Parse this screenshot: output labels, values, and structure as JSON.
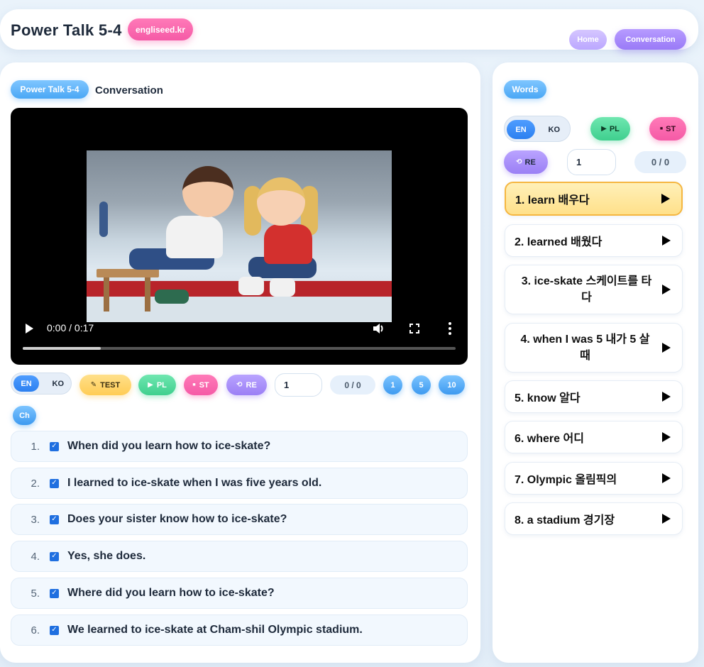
{
  "header": {
    "title": "Power Talk 5-4",
    "brand": "engliseed.kr",
    "home": "Home",
    "conversation": "Conversation"
  },
  "left": {
    "tag": "Power Talk 5-4",
    "label": "Conversation",
    "video": {
      "time": "0:00 / 0:17",
      "progress": 0.18
    },
    "controls": {
      "en": "EN",
      "ko": "KO",
      "test": "TEST",
      "pl": "PL",
      "st": "ST",
      "re": "RE",
      "repeat_value": "1",
      "counter": "0 / 0",
      "n1": "1",
      "n5": "5",
      "n10": "10",
      "ch": "Ch"
    },
    "sentences": [
      {
        "num": "1.",
        "text": "When did you learn how to ice-skate?"
      },
      {
        "num": "2.",
        "text": "I learned to ice-skate when I was five years old."
      },
      {
        "num": "3.",
        "text": "Does your sister know how to ice-skate?"
      },
      {
        "num": "4.",
        "text": "Yes, she does."
      },
      {
        "num": "5.",
        "text": "Where did you learn how to ice-skate?"
      },
      {
        "num": "6.",
        "text": "We learned to ice-skate at Cham-shil Olympic stadium."
      }
    ]
  },
  "right": {
    "tag": "Words",
    "controls": {
      "en": "EN",
      "ko": "KO",
      "pl": "PL",
      "st": "ST",
      "re": "RE",
      "repeat_value": "1",
      "counter": "0 / 0"
    },
    "words": [
      "1. learn 배우다",
      "2. learned 배웠다",
      "3. ice-skate 스케이트를 타다",
      "4. when I was 5 내가 5 살 때",
      "5. know 알다",
      "6. where 어디",
      "7. Olympic 올림픽의",
      "8. a stadium 경기장"
    ]
  },
  "colors": {
    "accent_blue": "#3d9af0",
    "pink": "#f55aa6",
    "purple": "#9b7ff5",
    "green": "#3fcf8e",
    "yellow": "#ffcc55",
    "active_word": "#ffe08a"
  },
  "icons": {
    "play": "play-icon",
    "volume": "volume-icon",
    "fullscreen": "fullscreen-icon",
    "more": "more-vertical-icon",
    "checkbox": "checkbox-checked-icon"
  }
}
